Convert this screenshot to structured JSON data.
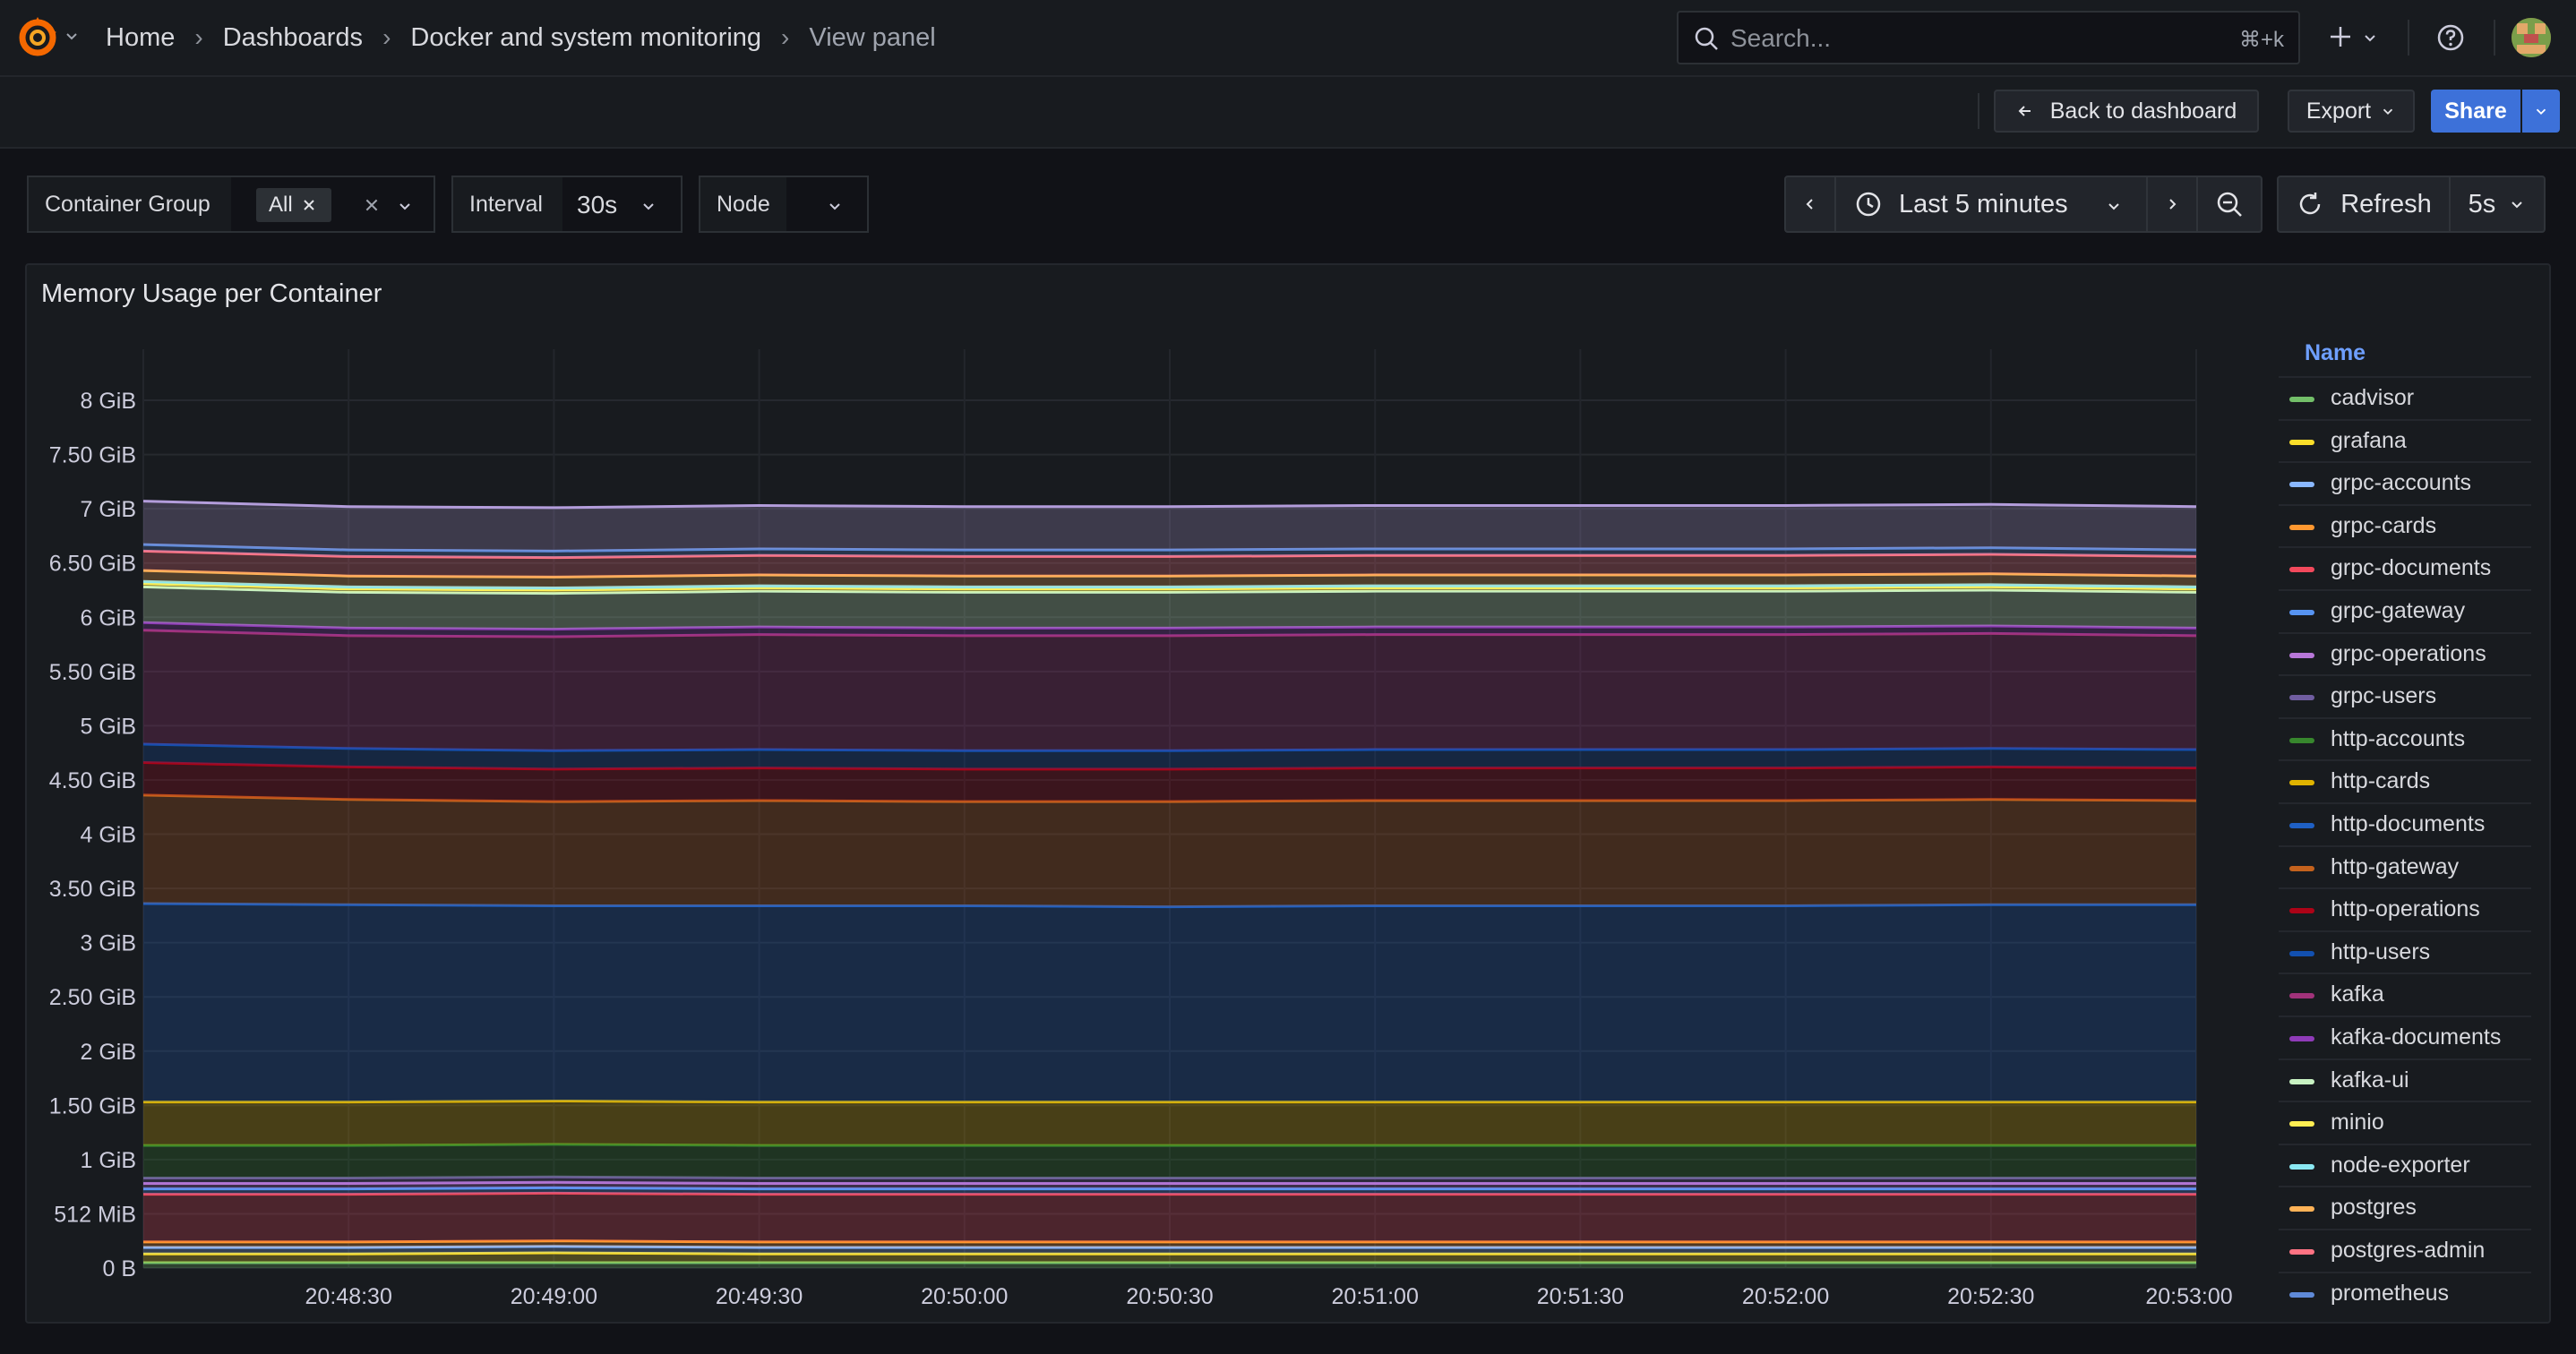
{
  "topbar": {
    "breadcrumbs": [
      "Home",
      "Dashboards",
      "Docker and system monitoring",
      "View panel"
    ],
    "search_placeholder": "Search...",
    "search_shortcut": "⌘+k"
  },
  "toolbar": {
    "back_label": "Back to dashboard",
    "export_label": "Export",
    "share_label": "Share"
  },
  "variables": {
    "container_group": {
      "label": "Container Group",
      "value": "All"
    },
    "interval": {
      "label": "Interval",
      "value": "30s"
    },
    "node": {
      "label": "Node",
      "value": ""
    }
  },
  "time_controls": {
    "range": "Last 5 minutes",
    "refresh_label": "Refresh",
    "refresh_interval": "5s"
  },
  "icons": [
    "grafana-logo-icon",
    "chevron-down-icon",
    "search-icon",
    "plus-icon",
    "help-icon",
    "arrow-left-icon",
    "clock-icon",
    "chevron-left-icon",
    "chevron-right-icon",
    "zoom-out-icon",
    "refresh-icon",
    "close-icon"
  ],
  "colors": {
    "accent": "#3d71d9",
    "legend_header": "#6e9fff"
  },
  "panel": {
    "title": "Memory Usage per Container",
    "legend_header": "Name"
  },
  "chart_data": {
    "type": "area",
    "stacked": true,
    "title": "Memory Usage per Container",
    "x": [
      "20:48:00",
      "20:48:30",
      "20:49:00",
      "20:49:30",
      "20:50:00",
      "20:50:30",
      "20:51:00",
      "20:51:30",
      "20:52:00",
      "20:52:30",
      "20:53:00"
    ],
    "x_tick_labels": [
      "20:48:30",
      "20:49:00",
      "20:49:30",
      "20:50:00",
      "20:50:30",
      "20:51:00",
      "20:51:30",
      "20:52:00",
      "20:52:30",
      "20:53:00"
    ],
    "y_unit": "GiB",
    "y_ticks": [
      "0 B",
      "512 MiB",
      "1 GiB",
      "1.50 GiB",
      "2 GiB",
      "2.50 GiB",
      "3 GiB",
      "3.50 GiB",
      "4 GiB",
      "4.50 GiB",
      "5 GiB",
      "5.50 GiB",
      "6 GiB",
      "6.50 GiB",
      "7 GiB",
      "7.50 GiB",
      "8 GiB"
    ],
    "ylim": [
      0,
      8
    ],
    "grid": true,
    "legend_position": "right",
    "series": [
      {
        "name": "cadvisor",
        "color": "#73bf69",
        "values": [
          0.05,
          0.05,
          0.05,
          0.05,
          0.05,
          0.05,
          0.05,
          0.05,
          0.05,
          0.05,
          0.05
        ]
      },
      {
        "name": "grafana",
        "color": "#fade2a",
        "values": [
          0.08,
          0.08,
          0.09,
          0.08,
          0.08,
          0.08,
          0.08,
          0.08,
          0.08,
          0.08,
          0.08
        ]
      },
      {
        "name": "grpc-accounts",
        "color": "#8ab8ff",
        "values": [
          0.06,
          0.06,
          0.06,
          0.06,
          0.06,
          0.06,
          0.06,
          0.06,
          0.06,
          0.06,
          0.06
        ]
      },
      {
        "name": "grpc-cards",
        "color": "#ff9830",
        "values": [
          0.05,
          0.05,
          0.05,
          0.05,
          0.05,
          0.05,
          0.05,
          0.05,
          0.05,
          0.05,
          0.05
        ]
      },
      {
        "name": "grpc-documents",
        "color": "#f2495c",
        "values": [
          0.44,
          0.44,
          0.44,
          0.44,
          0.44,
          0.44,
          0.44,
          0.44,
          0.44,
          0.44,
          0.44
        ]
      },
      {
        "name": "grpc-gateway",
        "color": "#5794f2",
        "values": [
          0.05,
          0.05,
          0.05,
          0.05,
          0.05,
          0.05,
          0.05,
          0.05,
          0.05,
          0.05,
          0.05
        ]
      },
      {
        "name": "grpc-operations",
        "color": "#b877d9",
        "values": [
          0.05,
          0.05,
          0.05,
          0.05,
          0.05,
          0.05,
          0.05,
          0.05,
          0.05,
          0.05,
          0.05
        ]
      },
      {
        "name": "grpc-users",
        "color": "#705da0",
        "values": [
          0.05,
          0.05,
          0.05,
          0.05,
          0.05,
          0.05,
          0.05,
          0.05,
          0.05,
          0.05,
          0.05
        ]
      },
      {
        "name": "http-accounts",
        "color": "#37872d",
        "values": [
          0.3,
          0.3,
          0.3,
          0.3,
          0.3,
          0.3,
          0.3,
          0.3,
          0.3,
          0.3,
          0.3
        ]
      },
      {
        "name": "http-cards",
        "color": "#e0b400",
        "values": [
          0.4,
          0.4,
          0.4,
          0.4,
          0.4,
          0.4,
          0.4,
          0.4,
          0.4,
          0.4,
          0.4
        ]
      },
      {
        "name": "http-documents",
        "color": "#1f60c4",
        "values": [
          1.83,
          1.82,
          1.8,
          1.81,
          1.81,
          1.8,
          1.81,
          1.81,
          1.81,
          1.82,
          1.82
        ]
      },
      {
        "name": "http-gateway",
        "color": "#c4621d",
        "values": [
          1.0,
          0.97,
          0.96,
          0.97,
          0.96,
          0.97,
          0.97,
          0.97,
          0.97,
          0.97,
          0.96
        ]
      },
      {
        "name": "http-operations",
        "color": "#ad0317",
        "values": [
          0.3,
          0.3,
          0.3,
          0.3,
          0.3,
          0.3,
          0.3,
          0.3,
          0.3,
          0.3,
          0.3
        ]
      },
      {
        "name": "http-users",
        "color": "#1250b0",
        "values": [
          0.17,
          0.17,
          0.17,
          0.17,
          0.17,
          0.17,
          0.17,
          0.17,
          0.17,
          0.17,
          0.17
        ]
      },
      {
        "name": "kafka",
        "color": "#a1327a",
        "values": [
          1.05,
          1.04,
          1.05,
          1.06,
          1.06,
          1.06,
          1.06,
          1.06,
          1.06,
          1.06,
          1.05
        ]
      },
      {
        "name": "kafka-documents",
        "color": "#8f3bb8",
        "values": [
          0.07,
          0.07,
          0.07,
          0.07,
          0.07,
          0.07,
          0.07,
          0.07,
          0.07,
          0.07,
          0.07
        ]
      },
      {
        "name": "kafka-ui",
        "color": "#c8f2c2",
        "values": [
          0.33,
          0.33,
          0.33,
          0.33,
          0.33,
          0.33,
          0.33,
          0.33,
          0.33,
          0.33,
          0.33
        ]
      },
      {
        "name": "minio",
        "color": "#ffee52",
        "values": [
          0.03,
          0.03,
          0.03,
          0.03,
          0.03,
          0.03,
          0.03,
          0.03,
          0.03,
          0.03,
          0.03
        ]
      },
      {
        "name": "node-exporter",
        "color": "#8ae8f2",
        "values": [
          0.02,
          0.02,
          0.02,
          0.02,
          0.02,
          0.02,
          0.02,
          0.02,
          0.02,
          0.02,
          0.02
        ]
      },
      {
        "name": "postgres",
        "color": "#ffb357",
        "values": [
          0.1,
          0.1,
          0.1,
          0.1,
          0.1,
          0.1,
          0.1,
          0.1,
          0.1,
          0.1,
          0.1
        ]
      },
      {
        "name": "postgres-admin",
        "color": "#ff7383",
        "values": [
          0.18,
          0.18,
          0.18,
          0.18,
          0.18,
          0.18,
          0.18,
          0.18,
          0.18,
          0.18,
          0.18
        ]
      },
      {
        "name": "prometheus",
        "color": "#5f8ad8",
        "values": [
          0.06,
          0.06,
          0.06,
          0.06,
          0.06,
          0.06,
          0.06,
          0.06,
          0.06,
          0.06,
          0.06
        ]
      },
      {
        "name": "",
        "color": "#b39ddb",
        "values": [
          0.4,
          0.4,
          0.4,
          0.4,
          0.4,
          0.4,
          0.4,
          0.4,
          0.4,
          0.4,
          0.4
        ]
      }
    ]
  }
}
